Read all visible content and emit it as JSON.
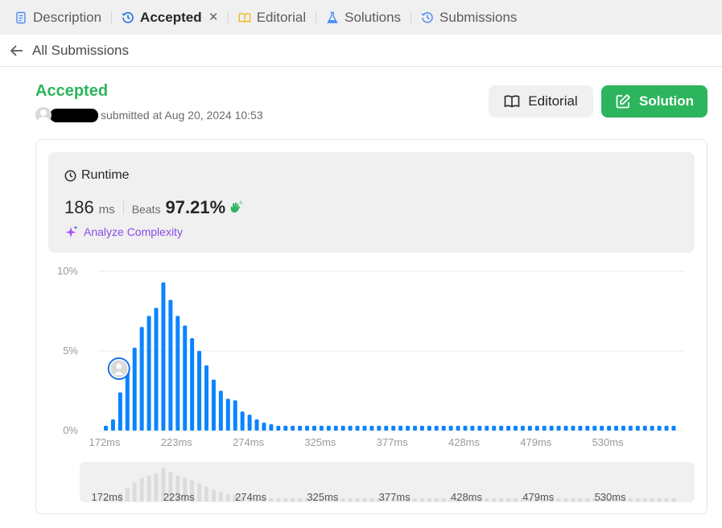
{
  "tabs": [
    {
      "label": "Description",
      "icon": "document-icon",
      "active": false
    },
    {
      "label": "Accepted",
      "icon": "history-icon",
      "active": true
    },
    {
      "label": "Editorial",
      "icon": "book-icon",
      "active": false
    },
    {
      "label": "Solutions",
      "icon": "flask-icon",
      "active": false
    },
    {
      "label": "Submissions",
      "icon": "history-icon",
      "active": false
    }
  ],
  "back": {
    "label": "All Submissions"
  },
  "submission": {
    "status": "Accepted",
    "submitted_text": "submitted at Aug 20, 2024 10:53"
  },
  "buttons": {
    "editorial": "Editorial",
    "solution": "Solution"
  },
  "runtime": {
    "title": "Runtime",
    "value": "186",
    "unit": "ms",
    "beats_label": "Beats",
    "beats_value": "97.21%",
    "analyze_label": "Analyze Complexity"
  },
  "colors": {
    "accent_green": "#2db55d",
    "bar_blue": "#0a84ff",
    "analyze_purple": "#8a4be8"
  },
  "chart_data": {
    "type": "bar",
    "ylabel": "",
    "yticks": [
      "10%",
      "5%",
      "0%"
    ],
    "ylim": [
      0,
      10
    ],
    "xticks": [
      "172ms",
      "223ms",
      "274ms",
      "325ms",
      "377ms",
      "428ms",
      "479ms",
      "530ms"
    ],
    "user_bin_index": 3,
    "values": [
      0.3,
      0.7,
      2.4,
      3.7,
      5.2,
      6.5,
      7.2,
      7.7,
      9.3,
      8.2,
      7.2,
      6.6,
      5.8,
      5.0,
      4.1,
      3.2,
      2.5,
      2.0,
      1.9,
      1.2,
      1.0,
      0.7,
      0.5,
      0.4,
      0.3,
      0.3,
      0.3,
      0.3,
      0.3,
      0.3,
      0.3,
      0.3,
      0.3,
      0.3,
      0.3,
      0.3,
      0.3,
      0.3,
      0.3,
      0.3,
      0.3,
      0.3,
      0.3,
      0.3,
      0.3,
      0.3,
      0.3,
      0.3,
      0.3,
      0.3,
      0.3,
      0.3,
      0.3,
      0.3,
      0.3,
      0.3,
      0.3,
      0.3,
      0.3,
      0.3,
      0.3,
      0.3,
      0.3,
      0.3,
      0.3,
      0.3,
      0.3,
      0.3,
      0.3,
      0.3,
      0.3,
      0.3,
      0.3,
      0.3,
      0.3,
      0.3,
      0.3,
      0.3,
      0.3,
      0.3
    ]
  }
}
